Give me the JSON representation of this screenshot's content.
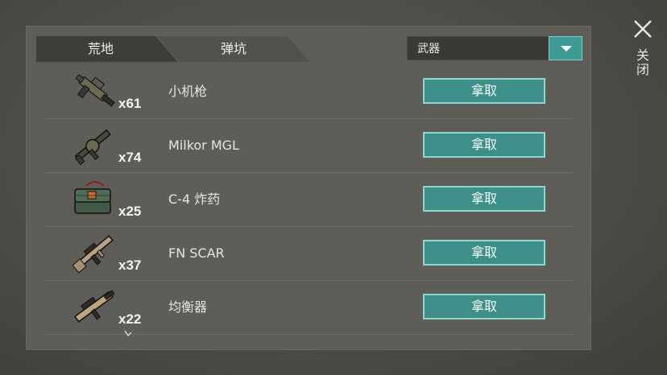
{
  "tabs": [
    {
      "label": "荒地",
      "active": true
    },
    {
      "label": "弹坑",
      "active": false
    }
  ],
  "filter": {
    "selected": "武器"
  },
  "close_label": "关闭",
  "colors": {
    "accent": "#3e8f89",
    "accent_border": "#8ed7d1",
    "panel": "#5f5d58"
  },
  "items": [
    {
      "name": "小机枪",
      "qty": "x61",
      "icon": "smg-icon",
      "button": "拿取"
    },
    {
      "name": "Milkor MGL",
      "qty": "x74",
      "icon": "grenade-launcher-icon",
      "button": "拿取"
    },
    {
      "name": "C-4 炸药",
      "qty": "x25",
      "icon": "c4-explosive-icon",
      "button": "拿取"
    },
    {
      "name": "FN SCAR",
      "qty": "x37",
      "icon": "rifle-icon",
      "button": "拿取"
    },
    {
      "name": "均衡器",
      "qty": "x22",
      "icon": "equalizer-gun-icon",
      "button": "拿取"
    }
  ]
}
